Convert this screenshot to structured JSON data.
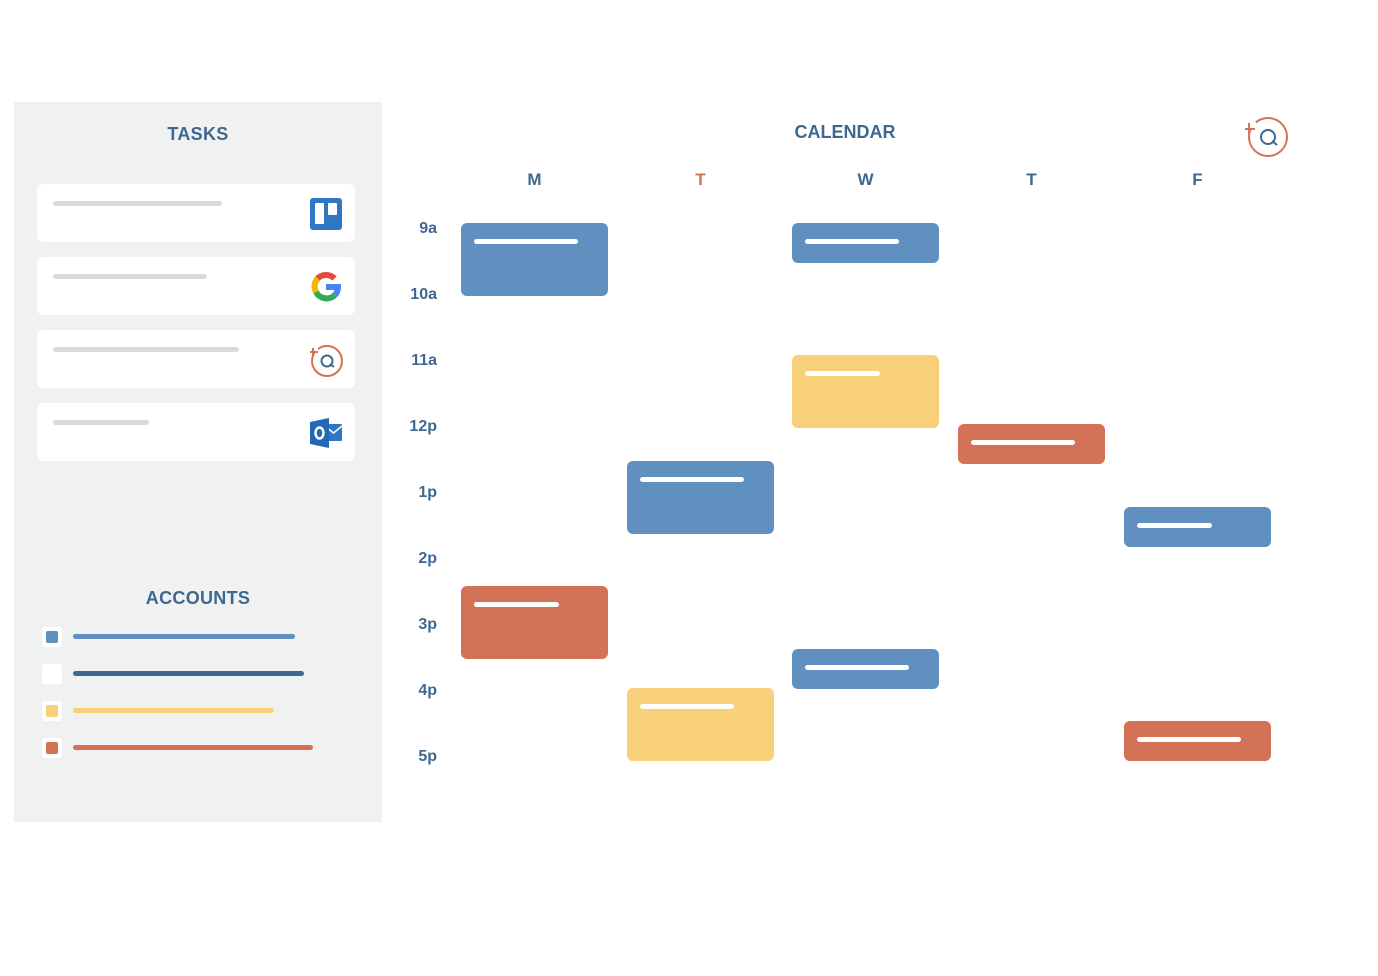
{
  "colors": {
    "blue": "#6090c0",
    "navy": "#3f6890",
    "orange": "#d37256",
    "yellow": "#f7d079",
    "panel": "#f0f1f1"
  },
  "tasks": {
    "title": "TASKS",
    "items": [
      {
        "icon": "trello-icon",
        "fill": 0.69
      },
      {
        "icon": "google-icon",
        "fill": 0.63
      },
      {
        "icon": "timely-icon",
        "fill": 0.76
      },
      {
        "icon": "outlook-icon",
        "fill": 0.39
      }
    ]
  },
  "accounts": {
    "title": "ACCOUNTS",
    "items": [
      {
        "swatch": "#6090c0",
        "line": "#6090c0",
        "fill": 0.74
      },
      {
        "swatch": "#ffffff",
        "line": "#3f6890",
        "fill": 0.77
      },
      {
        "swatch": "#f7d079",
        "line": "#f7d079",
        "fill": 0.67
      },
      {
        "swatch": "#d37256",
        "line": "#d37256",
        "fill": 0.8
      }
    ]
  },
  "calendar": {
    "title": "CALENDAR",
    "days": [
      {
        "label": "M",
        "color": "#3f6890"
      },
      {
        "label": "T",
        "color": "#d37256"
      },
      {
        "label": "W",
        "color": "#3f6890"
      },
      {
        "label": "T",
        "color": "#3f6890"
      },
      {
        "label": "F",
        "color": "#3f6890"
      }
    ],
    "times": [
      "9a",
      "10a",
      "11a",
      "12p",
      "1p",
      "2p",
      "3p",
      "4p",
      "5p"
    ],
    "events": [
      {
        "day": 0,
        "start": 9.0,
        "end": 10.1,
        "color": "#6090c0",
        "fill": 0.71
      },
      {
        "day": 2,
        "start": 9.0,
        "end": 9.6,
        "color": "#6090c0",
        "fill": 0.64
      },
      {
        "day": 2,
        "start": 11.0,
        "end": 12.1,
        "color": "#f7d079",
        "fill": 0.51
      },
      {
        "day": 3,
        "start": 12.05,
        "end": 12.65,
        "color": "#d37256",
        "fill": 0.71
      },
      {
        "day": 1,
        "start": 12.6,
        "end": 13.7,
        "color": "#6090c0",
        "fill": 0.71
      },
      {
        "day": 4,
        "start": 13.3,
        "end": 13.9,
        "color": "#6090c0",
        "fill": 0.51
      },
      {
        "day": 0,
        "start": 14.5,
        "end": 15.6,
        "color": "#d37256",
        "fill": 0.58
      },
      {
        "day": 2,
        "start": 15.45,
        "end": 16.05,
        "color": "#6090c0",
        "fill": 0.71
      },
      {
        "day": 1,
        "start": 16.05,
        "end": 17.15,
        "color": "#f7d079",
        "fill": 0.64
      },
      {
        "day": 4,
        "start": 16.55,
        "end": 17.15,
        "color": "#d37256",
        "fill": 0.71
      }
    ]
  }
}
